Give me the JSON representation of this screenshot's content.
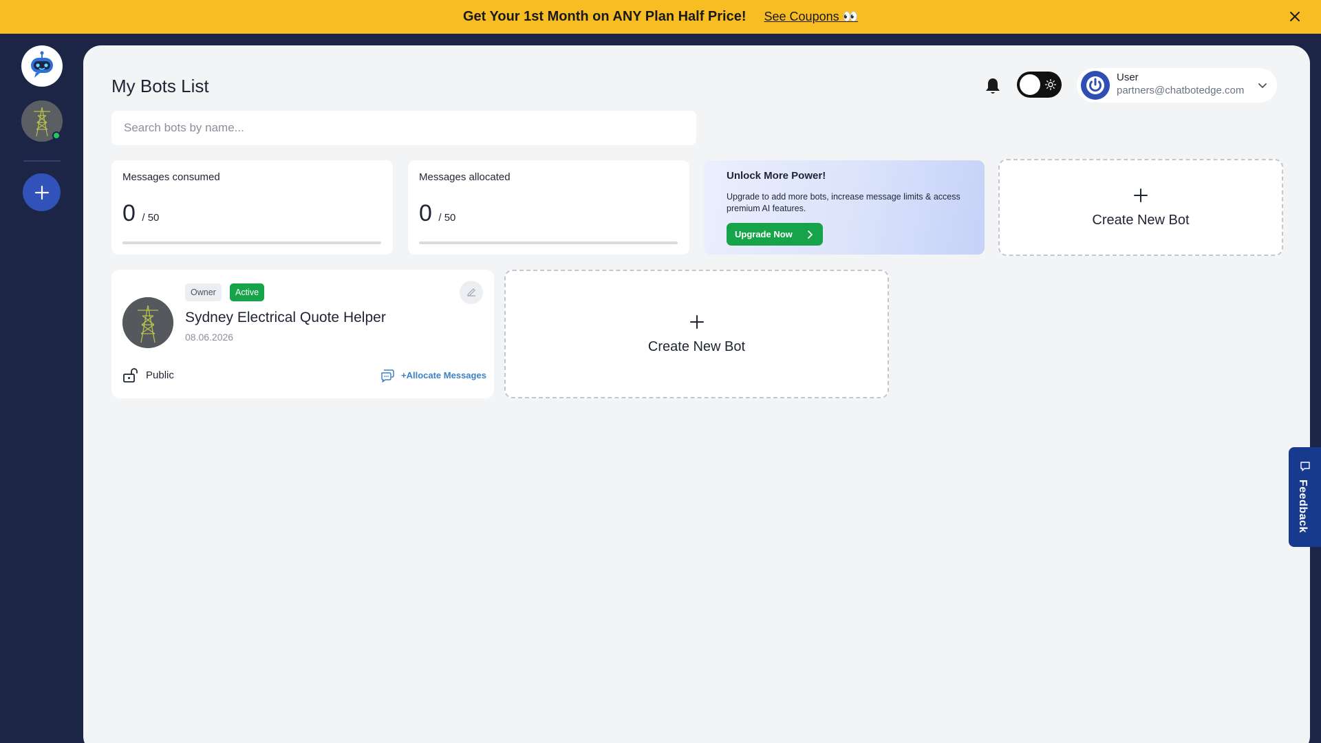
{
  "banner": {
    "text": "Get Your 1st Month on ANY Plan Half Price!",
    "link": "See Coupons 👀"
  },
  "header": {
    "title": "My Bots List",
    "user_name": "User",
    "user_email": "partners@chatbotedge.com"
  },
  "search": {
    "placeholder": "Search bots by name..."
  },
  "stats": [
    {
      "label": "Messages consumed",
      "value": "0",
      "total": "/ 50"
    },
    {
      "label": "Messages allocated",
      "value": "0",
      "total": "/ 50"
    }
  ],
  "promo": {
    "title": "Unlock More Power!",
    "description": "Upgrade to add more bots, increase message limits & access premium AI features.",
    "button": "Upgrade Now"
  },
  "create": {
    "label": "Create New Bot"
  },
  "bot": {
    "badge_owner": "Owner",
    "badge_status": "Active",
    "name": "Sydney Electrical Quote Helper",
    "date": "08.06.2026",
    "visibility": "Public",
    "allocate": "+Allocate Messages"
  },
  "feedback": {
    "label": "Feedback"
  },
  "colors": {
    "banner": "#f7bd22",
    "sidebar": "#1c2546",
    "accent": "#3152b8",
    "active_badge": "#16a34a",
    "feedback_tab": "#173a8f"
  }
}
